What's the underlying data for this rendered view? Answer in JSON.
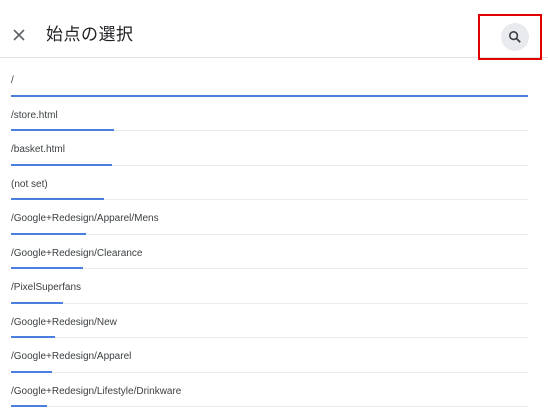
{
  "header": {
    "title": "始点の選択",
    "close_icon": "close-icon",
    "search_icon": "search-icon",
    "highlight_color": "#e00000"
  },
  "list": {
    "bar_color": "#4a7fe0",
    "items": [
      {
        "label": "/",
        "share": 1.0
      },
      {
        "label": "/store.html",
        "share": 0.2
      },
      {
        "label": "/basket.html",
        "share": 0.196
      },
      {
        "label": "(not set)",
        "share": 0.18
      },
      {
        "label": "/Google+Redesign/Apparel/Mens",
        "share": 0.145
      },
      {
        "label": "/Google+Redesign/Clearance",
        "share": 0.14
      },
      {
        "label": "/PixelSuperfans",
        "share": 0.1
      },
      {
        "label": "/Google+Redesign/New",
        "share": 0.085
      },
      {
        "label": "/Google+Redesign/Apparel",
        "share": 0.08
      },
      {
        "label": "/Google+Redesign/Lifestyle/Drinkware",
        "share": 0.07
      }
    ]
  }
}
